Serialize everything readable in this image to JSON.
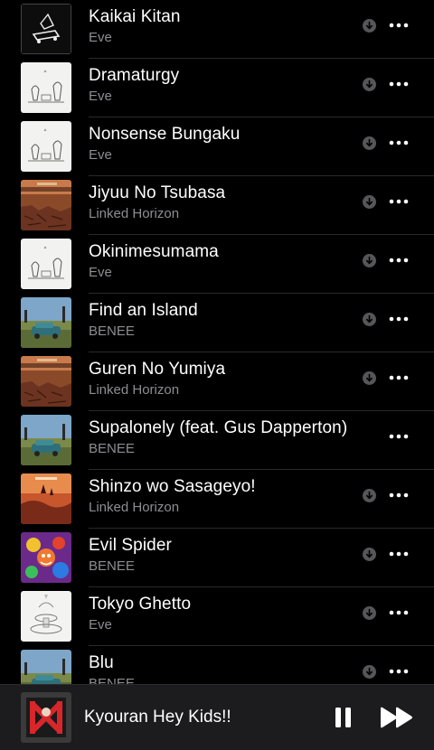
{
  "songs": [
    {
      "title": "Kaikai Kitan",
      "artist": "Eve",
      "downloadable": true,
      "art": "eve-bw"
    },
    {
      "title": "Dramaturgy",
      "artist": "Eve",
      "downloadable": true,
      "art": "eve-white"
    },
    {
      "title": "Nonsense Bungaku",
      "artist": "Eve",
      "downloadable": true,
      "art": "eve-white"
    },
    {
      "title": "Jiyuu No Tsubasa",
      "artist": "Linked Horizon",
      "downloadable": true,
      "art": "lh-desert"
    },
    {
      "title": "Okinimesumama",
      "artist": "Eve",
      "downloadable": true,
      "art": "eve-white"
    },
    {
      "title": "Find an Island",
      "artist": "BENEE",
      "downloadable": true,
      "art": "benee-car"
    },
    {
      "title": "Guren No Yumiya",
      "artist": "Linked Horizon",
      "downloadable": true,
      "art": "lh-desert"
    },
    {
      "title": "Supalonely (feat. Gus Dapperton)",
      "artist": "BENEE",
      "downloadable": false,
      "art": "benee-car"
    },
    {
      "title": "Shinzo wo Sasageyo!",
      "artist": "Linked Horizon",
      "downloadable": true,
      "art": "lh-fire"
    },
    {
      "title": "Evil Spider",
      "artist": "BENEE",
      "downloadable": true,
      "art": "benee-spider"
    },
    {
      "title": "Tokyo Ghetto",
      "artist": "Eve",
      "downloadable": true,
      "art": "eve-fountain"
    },
    {
      "title": "Blu",
      "artist": "BENEE",
      "downloadable": true,
      "art": "benee-car"
    }
  ],
  "now_playing": {
    "title": "Kyouran Hey Kids!!",
    "art": "oral-red"
  },
  "icons": {
    "download": "download-icon",
    "more": "ellipsis-icon",
    "pause": "pause-icon",
    "next": "forward-icon"
  }
}
